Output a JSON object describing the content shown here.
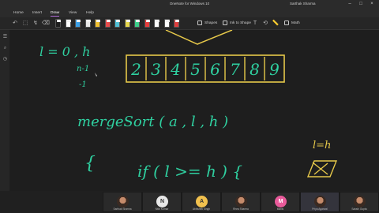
{
  "window": {
    "title": "OneNote for Windows 10",
    "user": "Sarthak Sharma"
  },
  "menu": [
    {
      "label": "Home"
    },
    {
      "label": "Insert"
    },
    {
      "label": "Draw"
    },
    {
      "label": "View"
    },
    {
      "label": "Help"
    }
  ],
  "toolbar": {
    "shapes_label": "Shapes",
    "ink_to_shape_label": "Ink to Shape",
    "math_label": "Math",
    "pen_colors": [
      "#1e1e1e",
      "#ffffff",
      "#3aa0e8",
      "#e8e8e8",
      "#f2c12e",
      "#e84a4a",
      "#4fc1d6",
      "#e8d84a",
      "#3ad08a",
      "#e83a3a",
      "#ffffff",
      "#ffffff",
      "#e03c3c"
    ]
  },
  "ink": {
    "color": "#2fd0a0",
    "array_border_color": "#e6c84a",
    "array_values": [
      "2",
      "3",
      "4",
      "5",
      "6",
      "7",
      "8",
      "9"
    ],
    "lines": {
      "l_zero_h": "l = 0 , h",
      "n_minus_1": "n-1",
      "minus_one": "-1",
      "merge_sort": "mergeSort ( a , l , h )",
      "open_brace": "{",
      "if_line": "if ( l >= h ) {",
      "l_eq_h": "l=h"
    }
  },
  "participants": [
    {
      "name": "Sarthak Sharma",
      "initial": "",
      "photo": true,
      "color": "#555555"
    },
    {
      "name": "Nitin Kumar",
      "initial": "N",
      "photo": false,
      "color": "#e8e8e8"
    },
    {
      "name": "Abhishek Singh",
      "initial": "A",
      "photo": false,
      "color": "#f2c14e"
    },
    {
      "name": "Rhea Sharma",
      "initial": "",
      "photo": true,
      "color": "#555555"
    },
    {
      "name": "Mansi",
      "initial": "M",
      "photo": false,
      "color": "#e85a9a"
    },
    {
      "name": "Priya Agarwal",
      "initial": "",
      "photo": true,
      "color": "#555555"
    },
    {
      "name": "Sakshi Gupta",
      "initial": "",
      "photo": true,
      "color": "#555555"
    }
  ]
}
